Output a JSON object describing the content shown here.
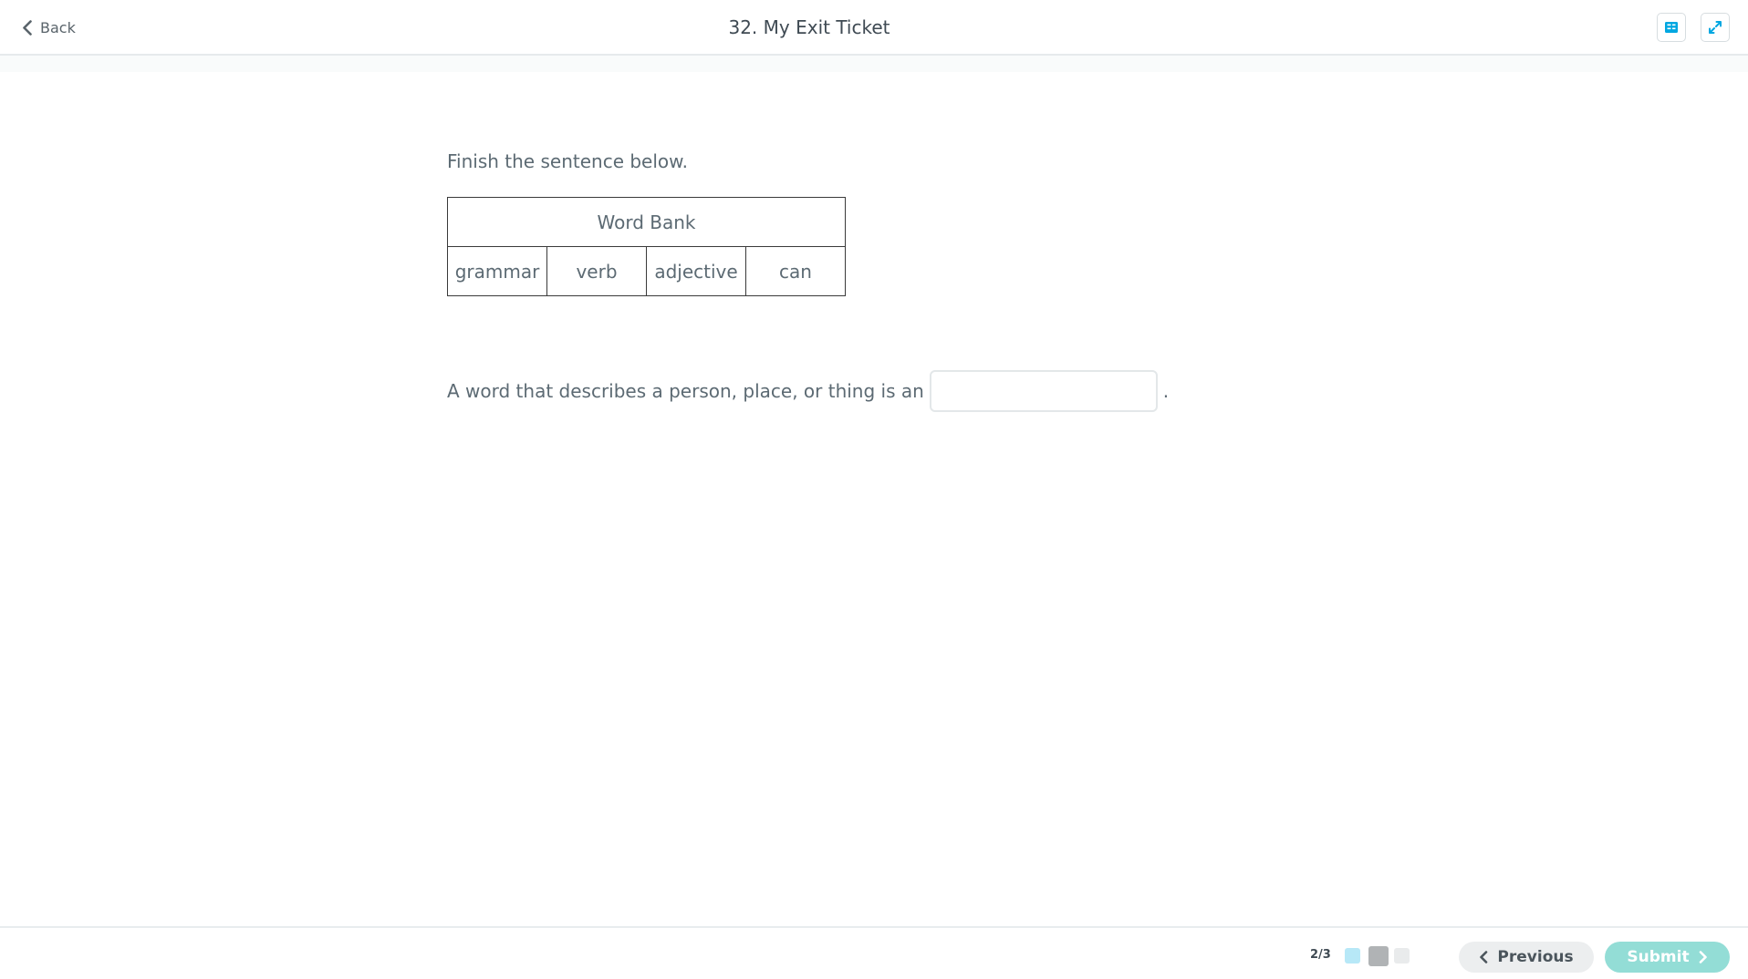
{
  "header": {
    "back_label": "Back",
    "title": "32. My Exit Ticket",
    "icons": [
      "calculator-icon",
      "expand-icon"
    ]
  },
  "question": {
    "prompt": "Finish the sentence below.",
    "word_bank": {
      "heading": "Word Bank",
      "words": [
        "grammar",
        "verb",
        "adjective",
        "can"
      ]
    },
    "sentence_before": "A word that describes a person, place, or thing is an",
    "answer_value": "",
    "sentence_after": "."
  },
  "footer": {
    "progress": "2/3",
    "previous_label": "Previous",
    "submit_label": "Submit"
  },
  "colors": {
    "accent": "#00a7e1",
    "submit_bg": "#93ddd6",
    "dot_done": "#b7e8f7",
    "dot_current": "#b0b3b5",
    "dot_upcoming": "#e9ebec"
  }
}
